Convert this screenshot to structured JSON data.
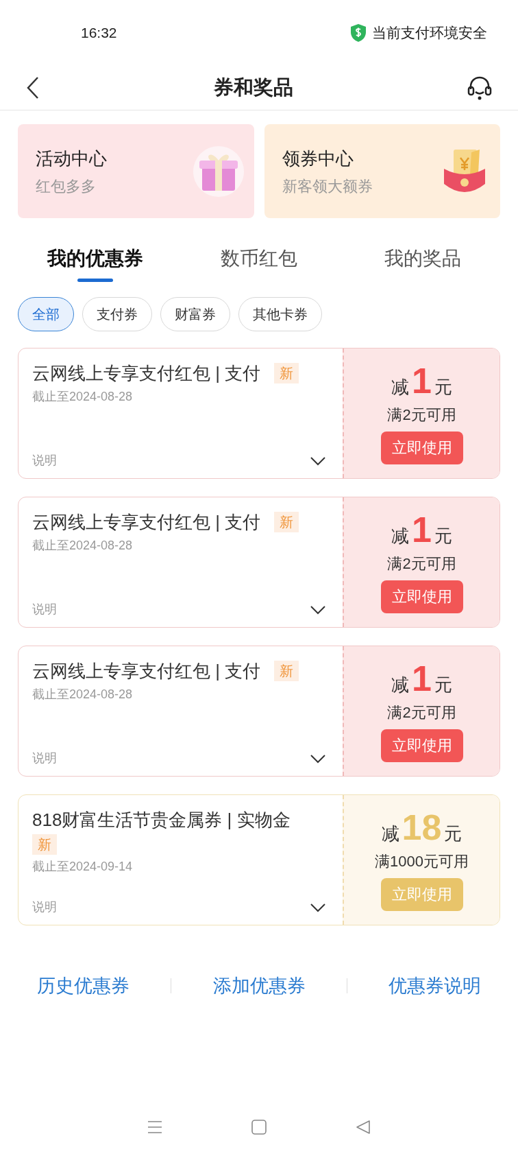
{
  "status_bar": {
    "time": "16:32",
    "security": "当前支付环境安全"
  },
  "header": {
    "title": "券和奖品"
  },
  "entries": [
    {
      "kind": "gift",
      "title": "活动中心",
      "subtitle": "红包多多"
    },
    {
      "kind": "envelope",
      "title": "领券中心",
      "subtitle": "新客领大额券"
    }
  ],
  "tabs": [
    {
      "label": "我的优惠券",
      "selected": true
    },
    {
      "label": "数币红包",
      "selected": false
    },
    {
      "label": "我的奖品",
      "selected": false
    }
  ],
  "filters": [
    {
      "label": "全部",
      "selected": true
    },
    {
      "label": "支付券",
      "selected": false
    },
    {
      "label": "财富券",
      "selected": false
    },
    {
      "label": "其他卡券",
      "selected": false
    }
  ],
  "coupons": [
    {
      "kind": "red",
      "title": "云网线上专享支付红包 | 支付",
      "badge": "新",
      "expiry": "截止至2024-08-28",
      "details": "说明",
      "prefix": "减",
      "amount": "1",
      "unit": "元",
      "condition": "满2元可用",
      "action": "立即使用"
    },
    {
      "kind": "red",
      "title": "云网线上专享支付红包 | 支付",
      "badge": "新",
      "expiry": "截止至2024-08-28",
      "details": "说明",
      "prefix": "减",
      "amount": "1",
      "unit": "元",
      "condition": "满2元可用",
      "action": "立即使用"
    },
    {
      "kind": "red",
      "title": "云网线上专享支付红包 | 支付",
      "badge": "新",
      "expiry": "截止至2024-08-28",
      "details": "说明",
      "prefix": "减",
      "amount": "1",
      "unit": "元",
      "condition": "满2元可用",
      "action": "立即使用"
    },
    {
      "kind": "gold",
      "title": "818财富生活节贵金属券 | 实物金",
      "badge": "新",
      "expiry": "截止至2024-09-14",
      "details": "说明",
      "prefix": "减",
      "amount": "18",
      "unit": "元",
      "condition": "满1000元可用",
      "action": "立即使用"
    }
  ],
  "footer_links": [
    "历史优惠券",
    "添加优惠券",
    "优惠券说明"
  ]
}
